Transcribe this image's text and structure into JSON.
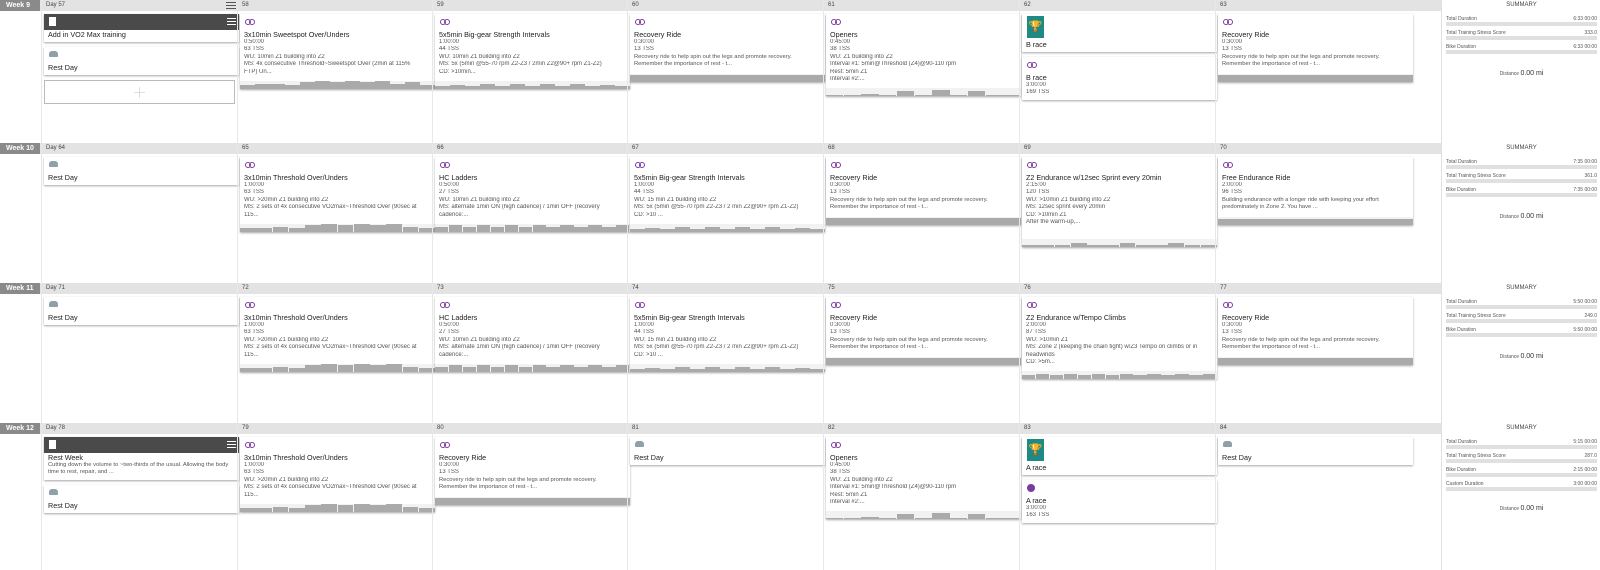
{
  "weeks": [
    {
      "label": "Week 9",
      "days": [
        {
          "num": "Day 57",
          "menu": true,
          "cards": [
            {
              "type": "note",
              "title": "Add in VO2 Max training"
            },
            {
              "type": "rest",
              "title": "Rest Day"
            },
            {
              "type": "add"
            }
          ]
        },
        {
          "num": "58",
          "cards": [
            {
              "type": "bike",
              "title": "3x10min Sweetspot Over/Unders",
              "lines": [
                "0:50:00",
                "63 TSS",
                "WU: 10min Z1 building into Z2",
                "MS: 4x consecutive Threshold~Sweetspot Over (2min at 115%",
                "FTP) Un..."
              ],
              "profile": [
                3,
                4,
                4,
                3,
                5,
                6,
                5,
                6,
                5,
                6,
                4,
                5,
                3
              ]
            }
          ]
        },
        {
          "num": "59",
          "cards": [
            {
              "type": "bike",
              "title": "5x5min Big-gear Strength Intervals",
              "lines": [
                "1:00:00",
                "44 TSS",
                "WU: 10min Z1 building into Z2",
                "MS: 5x (5min @55-70 rpm Z2-Z3 / 2min Z2@90+ rpm Z1-Z2)",
                "CD: >10min..."
              ],
              "profile": [
                2,
                3,
                2,
                4,
                2,
                4,
                2,
                4,
                2,
                4,
                2,
                3,
                2
              ]
            }
          ]
        },
        {
          "num": "60",
          "cards": [
            {
              "type": "bike",
              "title": "Recovery Ride",
              "lines": [
                "0:30:00",
                "13 TSS"
              ],
              "desc": "Recovery ride to help spin out the legs and promote recovery. Remember the importance of rest - t...",
              "profile": [
                5
              ]
            }
          ]
        },
        {
          "num": "61",
          "cards": [
            {
              "type": "bike",
              "title": "Openers",
              "lines": [
                "0:45:00",
                "38 TSS",
                "WU: Z1 building into Z2",
                "Interval #1: 5min@Threshold (Z4)@90-110 rpm",
                "Rest: 5min Z1",
                "Interval #2:..."
              ],
              "profile": [
                1,
                1,
                2,
                1,
                4,
                1,
                5,
                1,
                4,
                1,
                1
              ]
            }
          ]
        },
        {
          "num": "62",
          "cards": [
            {
              "type": "trophy",
              "title": "B race"
            },
            {
              "type": "bike",
              "title": "B race",
              "lines": [
                "3:00:00",
                "169 TSS"
              ]
            }
          ]
        },
        {
          "num": "63",
          "cards": [
            {
              "type": "bike",
              "title": "Recovery Ride",
              "lines": [
                "0:30:00",
                "13 TSS"
              ],
              "desc": "Recovery ride to help spin out the legs and promote recovery. Remember the importance of rest - t...",
              "profile": [
                5
              ]
            }
          ]
        }
      ],
      "summary": {
        "title": "SUMMARY",
        "rows": [
          {
            "label": "Total Duration",
            "value": "6:33 00:00"
          },
          {
            "label": "Total Training Stress Score",
            "value": "333.0"
          },
          {
            "label": "Bike Duration",
            "value": "6:33 00:00"
          }
        ],
        "dist_label": "Distance",
        "dist_value": "0.00 mi"
      }
    },
    {
      "label": "Week 10",
      "days": [
        {
          "num": "Day 64",
          "cards": [
            {
              "type": "rest",
              "title": "Rest Day"
            }
          ]
        },
        {
          "num": "65",
          "cards": [
            {
              "type": "bike",
              "title": "3x10min Threshold Over/Unders",
              "lines": [
                "1:00:00",
                "63 TSS",
                "WU: >20min Z1 building into Z2",
                "MS: 2 sets of 4x consecutive VO2max~Threshold Over (90sec at",
                "115..."
              ],
              "profile": [
                3,
                3,
                4,
                3,
                5,
                6,
                5,
                6,
                5,
                6,
                4,
                3
              ]
            }
          ]
        },
        {
          "num": "66",
          "cards": [
            {
              "type": "bike",
              "title": "HC Ladders",
              "lines": [
                "0:50:00",
                "27 TSS",
                "WU: 10min Z1 building into Z2",
                "MS: alternate 1min ON (high cadence) / 1min OFF (recovery",
                "cadence:..."
              ],
              "profile": [
                4,
                5,
                4,
                5,
                4,
                5,
                4,
                5,
                4,
                5,
                4,
                5,
                4,
                5
              ]
            }
          ]
        },
        {
          "num": "67",
          "cards": [
            {
              "type": "bike",
              "title": "5x5min Big-gear Strength Intervals",
              "lines": [
                "1:00:00",
                "44 TSS",
                "WU: 15 min Z1 building into Z2",
                "MS: 5x (5min @55-70 rpm Z2-Z3 / 2 min Z2@90+ rpm Z1-Z2)",
                "CD: >10 ..."
              ],
              "profile": [
                2,
                3,
                2,
                4,
                2,
                4,
                2,
                4,
                2,
                4,
                2,
                3,
                2
              ]
            }
          ]
        },
        {
          "num": "68",
          "cards": [
            {
              "type": "bike",
              "title": "Recovery Ride",
              "lines": [
                "0:30:00",
                "13 TSS"
              ],
              "desc": "Recovery ride to help spin out the legs and promote recovery. Remember the importance of rest - t...",
              "profile": [
                5
              ]
            }
          ]
        },
        {
          "num": "69",
          "cards": [
            {
              "type": "bike",
              "title": "Z2 Endurance w/12sec Sprint every 20min",
              "lines": [
                "2:15:00",
                "120 TSS",
                "WU: >10min Z1 building into Z2",
                "MS: 12sec sprint every 20min",
                "CD: >10min Z1",
                "",
                "After the warm-up,..."
              ],
              "profile": [
                1,
                1,
                1,
                3,
                1,
                1,
                3,
                1,
                1,
                3,
                1,
                1
              ]
            }
          ]
        },
        {
          "num": "70",
          "cards": [
            {
              "type": "bike",
              "title": "Free Endurance Ride",
              "lines": [
                "2:00:00",
                "96 TSS"
              ],
              "desc": "Building endurance with a longer ride with keeping your effort predominately in Zone 2. You have ...",
              "profile": [
                4
              ]
            }
          ]
        }
      ],
      "summary": {
        "title": "SUMMARY",
        "rows": [
          {
            "label": "Total Duration",
            "value": "7:35 00:00"
          },
          {
            "label": "Total Training Stress Score",
            "value": "361.0"
          },
          {
            "label": "Bike Duration",
            "value": "7:35 00:00"
          }
        ],
        "dist_label": "Distance",
        "dist_value": "0.00 mi"
      }
    },
    {
      "label": "Week 11",
      "days": [
        {
          "num": "Day 71",
          "cards": [
            {
              "type": "rest",
              "title": "Rest Day"
            }
          ]
        },
        {
          "num": "72",
          "cards": [
            {
              "type": "bike",
              "title": "3x10min Threshold Over/Unders",
              "lines": [
                "1:00:00",
                "63 TSS",
                "WU: >20min Z1 building into Z2",
                "MS: 2 sets of 4x consecutive VO2max~Threshold Over (90sec at",
                "115..."
              ],
              "profile": [
                3,
                3,
                4,
                3,
                5,
                6,
                5,
                6,
                5,
                6,
                4,
                3
              ]
            }
          ]
        },
        {
          "num": "73",
          "cards": [
            {
              "type": "bike",
              "title": "HC Ladders",
              "lines": [
                "0:50:00",
                "27 TSS",
                "WU: 10min Z1 building into Z2",
                "MS: alternate 1min ON (high cadence) / 1min OFF (recovery",
                "cadence:..."
              ],
              "profile": [
                4,
                5,
                4,
                5,
                4,
                5,
                4,
                5,
                4,
                5,
                4,
                5,
                4,
                5
              ]
            }
          ]
        },
        {
          "num": "74",
          "cards": [
            {
              "type": "bike",
              "title": "5x5min Big-gear Strength Intervals",
              "lines": [
                "1:00:00",
                "44 TSS",
                "WU: 15 min Z1 building into Z2",
                "MS: 5x (5min @55-70 rpm Z2-Z3 / 2 min Z2@90+ rpm Z1-Z2)",
                "CD: >10 ..."
              ],
              "profile": [
                2,
                3,
                2,
                4,
                2,
                4,
                2,
                4,
                2,
                4,
                2,
                3,
                2
              ]
            }
          ]
        },
        {
          "num": "75",
          "cards": [
            {
              "type": "bike",
              "title": "Recovery Ride",
              "lines": [
                "0:30:00",
                "13 TSS"
              ],
              "desc": "Recovery ride to help spin out the legs and promote recovery. Remember the importance of rest - t...",
              "profile": [
                5
              ]
            }
          ]
        },
        {
          "num": "76",
          "cards": [
            {
              "type": "bike",
              "title": "Z2 Endurance w/Tempo Climbs",
              "lines": [
                "2:00:00",
                "87 TSS",
                "WU: >10min Z1",
                "MS: Zone 2 (keeping the chain tight) w/Z3 Tempo on climbs or in",
                "headwinds",
                "CD: >5m..."
              ],
              "profile": [
                3,
                4,
                3,
                4,
                3,
                4,
                3,
                4,
                3,
                4,
                3,
                4,
                3,
                4
              ]
            }
          ]
        },
        {
          "num": "77",
          "cards": [
            {
              "type": "bike",
              "title": "Recovery Ride",
              "lines": [
                "0:30:00",
                "13 TSS"
              ],
              "desc": "Recovery ride to help spin out the legs and promote recovery. Remember the importance of rest - t...",
              "profile": [
                5
              ]
            }
          ]
        }
      ],
      "summary": {
        "title": "SUMMARY",
        "rows": [
          {
            "label": "Total Duration",
            "value": "5:50 00:00"
          },
          {
            "label": "Total Training Stress Score",
            "value": "249.0"
          },
          {
            "label": "Bike Duration",
            "value": "5:50 00:00"
          }
        ],
        "dist_label": "Distance",
        "dist_value": "0.00 mi"
      }
    },
    {
      "label": "Week 12",
      "days": [
        {
          "num": "Day 78",
          "cards": [
            {
              "type": "note",
              "title": "Rest Week",
              "desc": "Cutting down the volume to ~two-thirds of the usual. Allowing the body time to rest, repair, and ..."
            },
            {
              "type": "rest",
              "title": "Rest Day"
            }
          ]
        },
        {
          "num": "79",
          "cards": [
            {
              "type": "bike",
              "title": "3x10min Threshold Over/Unders",
              "lines": [
                "1:00:00",
                "63 TSS",
                "WU: >20min Z1 building into Z2",
                "MS: 2 sets of 4x consecutive VO2max~Threshold Over (90sec at",
                "115..."
              ],
              "profile": [
                3,
                3,
                4,
                3,
                5,
                6,
                5,
                6,
                5,
                6,
                4,
                3
              ]
            }
          ]
        },
        {
          "num": "80",
          "cards": [
            {
              "type": "bike",
              "title": "Recovery Ride",
              "lines": [
                "0:30:00",
                "13 TSS"
              ],
              "desc": "Recovery ride to help spin out the legs and promote recovery. Remember the importance of rest - t...",
              "profile": [
                5
              ]
            }
          ]
        },
        {
          "num": "81",
          "cards": [
            {
              "type": "rest",
              "title": "Rest Day"
            }
          ]
        },
        {
          "num": "82",
          "cards": [
            {
              "type": "bike",
              "title": "Openers",
              "lines": [
                "0:45:00",
                "38 TSS",
                "WU: Z1 building into Z2",
                "Interval #1: 5min@Threshold (Z4)@90-110 rpm",
                "Rest: 5min Z1",
                "Interval #2:..."
              ],
              "profile": [
                1,
                1,
                2,
                1,
                4,
                1,
                5,
                1,
                4,
                1,
                1
              ]
            }
          ]
        },
        {
          "num": "83",
          "cards": [
            {
              "type": "trophy",
              "title": "A race"
            },
            {
              "type": "race",
              "title": "A race",
              "lines": [
                "3:00:00",
                "163 TSS"
              ]
            }
          ]
        },
        {
          "num": "84",
          "cards": [
            {
              "type": "rest",
              "title": "Rest Day"
            }
          ]
        }
      ],
      "summary": {
        "title": "SUMMARY",
        "rows": [
          {
            "label": "Total Duration",
            "value": "5:15 00:00"
          },
          {
            "label": "Total Training Stress Score",
            "value": "287.0"
          },
          {
            "label": "Bike Duration",
            "value": "2:15 00:00"
          },
          {
            "label": "Custom Duration",
            "value": "3:00 00:00"
          }
        ],
        "dist_label": "Distance",
        "dist_value": "0.00 mi"
      }
    }
  ]
}
